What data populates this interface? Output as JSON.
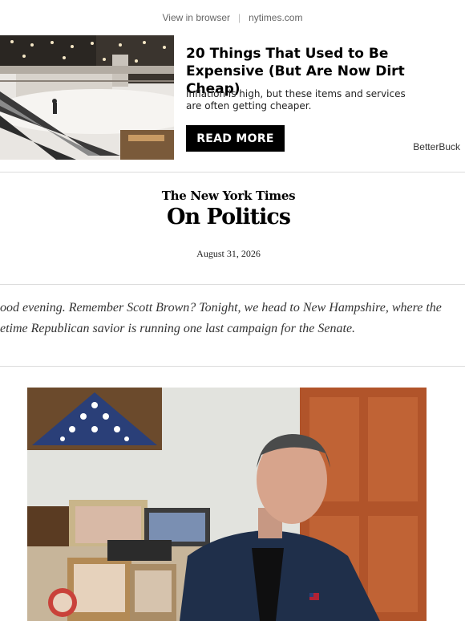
{
  "topbar": {
    "view_in_browser": "View in browser",
    "separator": "|",
    "site": "nytimes.com"
  },
  "ad": {
    "image_alt": "escalator-mall-photo",
    "title": "20 Things That Used to Be Expensive (But Are Now Dirt Cheap)",
    "description": "Inflation is high, but these items and services are often getting cheaper.",
    "button_label": "READ MORE",
    "sponsor": "BetterBuck"
  },
  "masthead": {
    "logo_text": "The New York Times",
    "newsletter_name": "On Politics",
    "date": "August 31, 2026"
  },
  "intro": {
    "line1": "ood evening. Remember Scott Brown? Tonight, we head to New Hampshire, where the",
    "line2": "etime Republican savior is running one last campaign for the Senate."
  },
  "photo": {
    "subject": "scott-brown-portrait"
  },
  "colors": {
    "button_bg": "#000000",
    "divider": "#dcdcdc",
    "muted_text": "#666666"
  }
}
